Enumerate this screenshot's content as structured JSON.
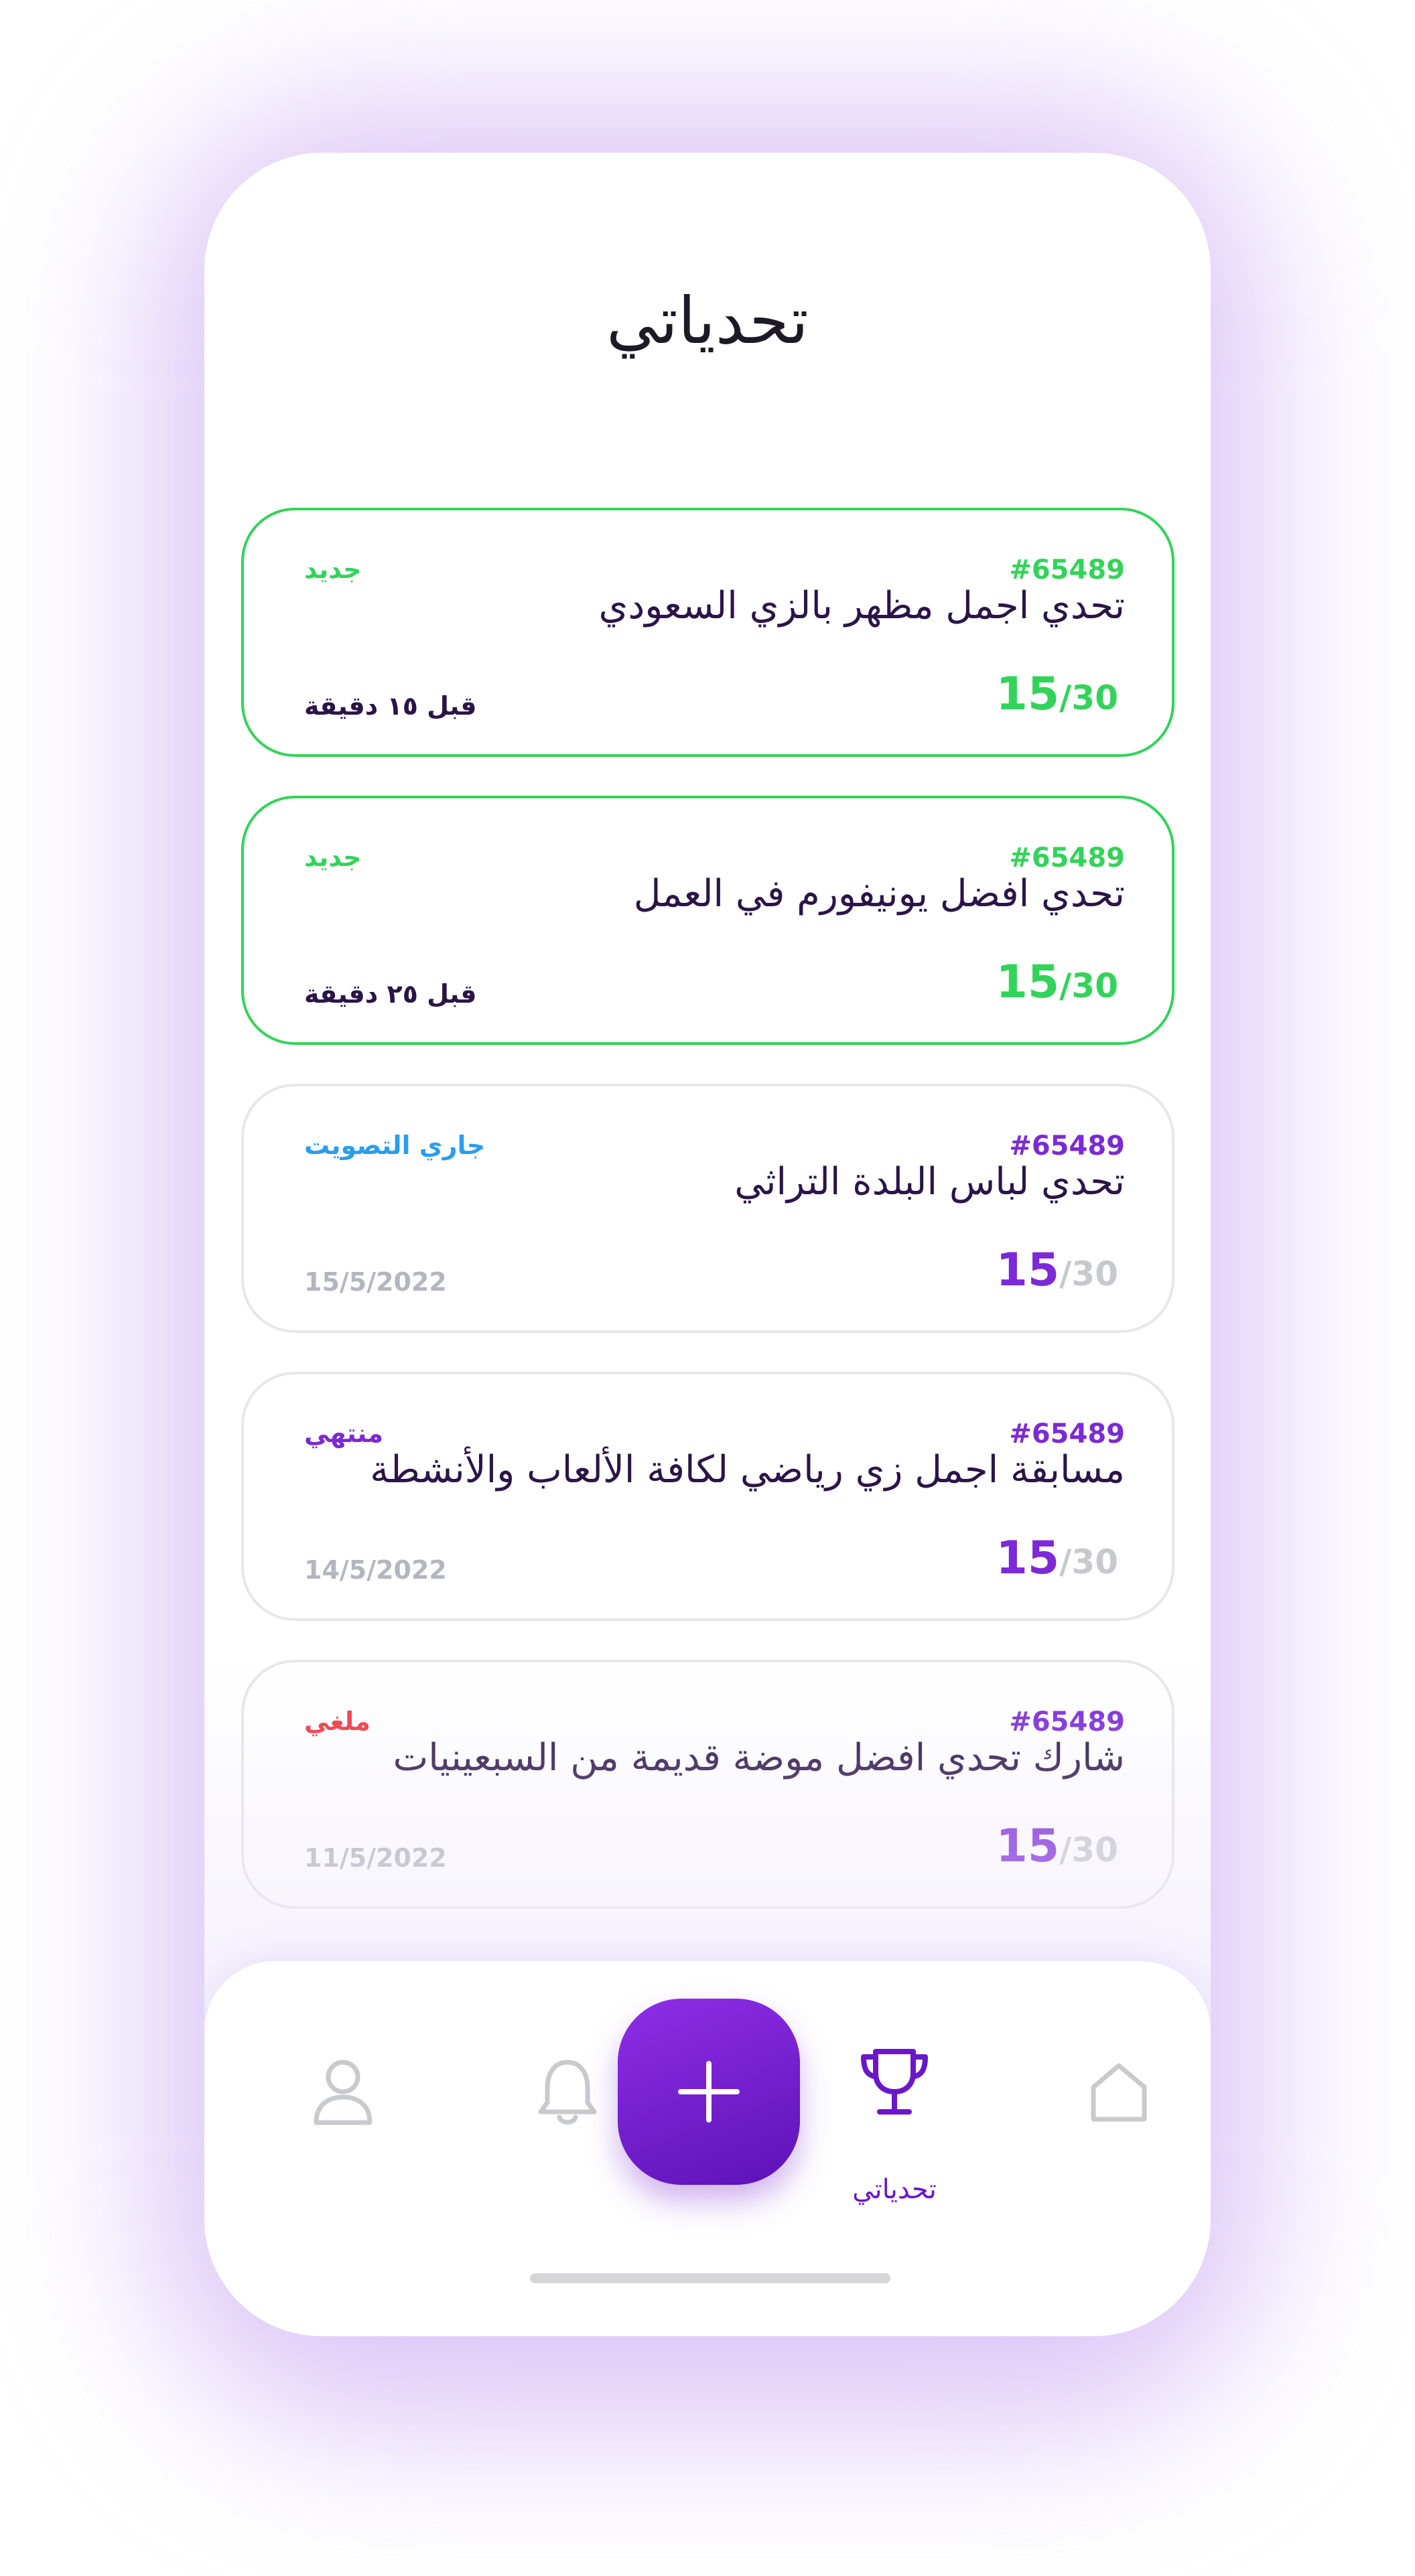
{
  "page": {
    "title": "تحدياتي"
  },
  "cards": [
    {
      "id": "#65489",
      "title": "تحدي اجمل مظهر بالزي السعودي",
      "status": "جديد",
      "score": "15",
      "total": "30",
      "meta": "قبل ١٥ دقيقة",
      "accent": "#33d35a",
      "status_color": "#33d35a",
      "meta_color": "#2a1547",
      "total_color": "#33d35a"
    },
    {
      "id": "#65489",
      "title": "تحدي افضل يونيفورم في العمل",
      "status": "جديد",
      "score": "15",
      "total": "30",
      "meta": "قبل ٢٥ دقيقة",
      "accent": "#33d35a",
      "status_color": "#33d35a",
      "meta_color": "#2a1547",
      "total_color": "#33d35a"
    },
    {
      "id": "#65489",
      "title": "تحدي لباس البلدة التراثي",
      "status": "جاري التصويت",
      "score": "15",
      "total": "30",
      "meta": "15/5/2022",
      "accent": "#7b2ad6",
      "status_color": "#2a9df0",
      "meta_color": "#b3b6bf",
      "total_color": "#c8c9cf"
    },
    {
      "id": "#65489",
      "title": "مسابقة اجمل زي رياضي لكافة الألعاب والأنشطة",
      "status": "منتهي",
      "score": "15",
      "total": "30",
      "meta": "14/5/2022",
      "accent": "#7b2ad6",
      "status_color": "#7b2ad6",
      "meta_color": "#b3b6bf",
      "total_color": "#c8c9cf"
    },
    {
      "id": "#65489",
      "title": "شارك تحدي افضل موضة قديمة من السبعينيات",
      "status": "ملغي",
      "score": "15",
      "total": "30",
      "meta": "11/5/2022",
      "accent": "#7b2ad6",
      "status_color": "#f0343c",
      "meta_color": "#b3b6bf",
      "total_color": "#c8c9cf"
    }
  ],
  "nav": {
    "items": [
      {
        "icon": "profile-icon",
        "active": false
      },
      {
        "icon": "bell-icon",
        "active": false
      },
      {
        "icon": "plus-icon",
        "active": false
      },
      {
        "icon": "trophy-icon",
        "active": true,
        "label": "تحدياتي"
      },
      {
        "icon": "home-icon",
        "active": false
      }
    ]
  },
  "colors": {
    "primary": "#6a17c9",
    "new": "#33d35a",
    "voting": "#2a9df0",
    "cancelled": "#f0343c",
    "muted": "#c8c9cf"
  }
}
